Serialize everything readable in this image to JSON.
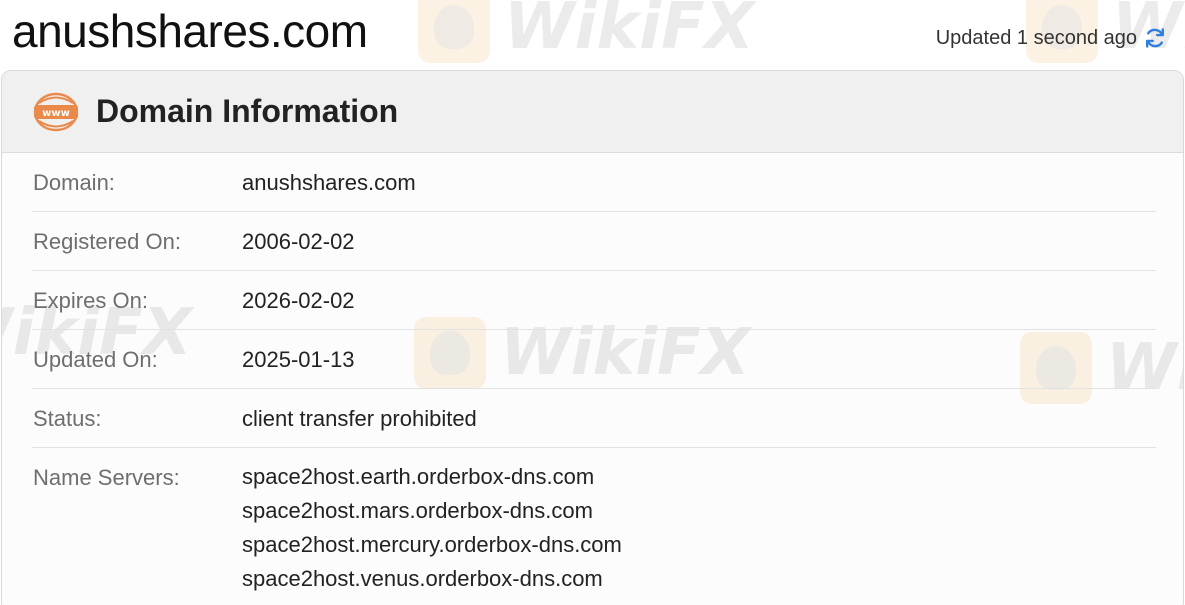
{
  "page": {
    "title": "anushshares.com",
    "updated_text": "Updated 1 second ago",
    "refresh_icon": "refresh-icon",
    "accent_color": "#2f7fe0"
  },
  "card": {
    "header_icon": "www-icon",
    "header_icon_text": "www",
    "header_title": "Domain Information",
    "rows": [
      {
        "label": "Domain:",
        "value": "anushshares.com"
      },
      {
        "label": "Registered On:",
        "value": "2006-02-02"
      },
      {
        "label": "Expires On:",
        "value": "2026-02-02"
      },
      {
        "label": "Updated On:",
        "value": "2025-01-13"
      },
      {
        "label": "Status:",
        "value": "client transfer prohibited"
      }
    ],
    "name_servers": {
      "label": "Name Servers:",
      "values": [
        "space2host.earth.orderbox-dns.com",
        "space2host.mars.orderbox-dns.com",
        "space2host.mercury.orderbox-dns.com",
        "space2host.venus.orderbox-dns.com"
      ]
    }
  },
  "watermark": {
    "text": "WikiFX"
  }
}
